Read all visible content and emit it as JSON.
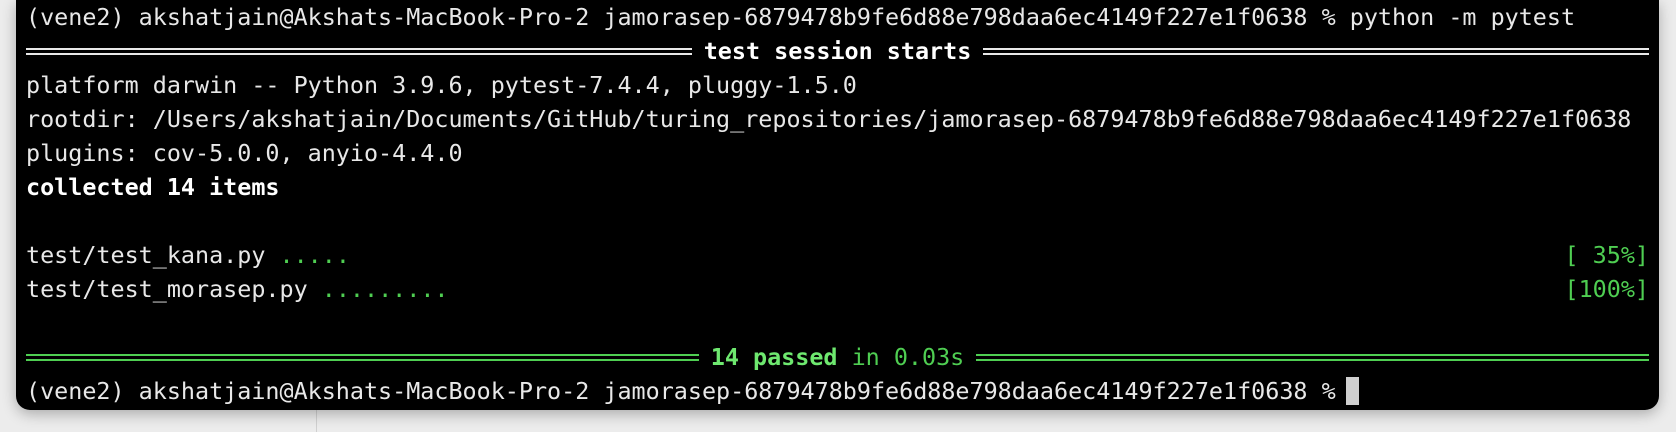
{
  "terminal": {
    "command_line": "(vene2) akshatjain@Akshats-MacBook-Pro-2 jamorasep-6879478b9fe6d88e798daa6ec4149f227e1f0638 % python -m pytest",
    "session_header": "test session starts",
    "platform_line": "platform darwin -- Python 3.9.6, pytest-7.4.4, pluggy-1.5.0",
    "rootdir_line": "rootdir: /Users/akshatjain/Documents/GitHub/turing_repositories/jamorasep-6879478b9fe6d88e798daa6ec4149f227e1f0638",
    "plugins_line": "plugins: cov-5.0.0, anyio-4.4.0",
    "collected_line": "collected 14 items",
    "tests": [
      {
        "file": "test/test_kana.py",
        "dots": ".....",
        "progress": "[ 35%]"
      },
      {
        "file": "test/test_morasep.py",
        "dots": ".........",
        "progress": "[100%]"
      }
    ],
    "summary": {
      "passed": "14 passed",
      "duration": "in 0.03s"
    },
    "prompt_line": "(vene2) akshatjain@Akshats-MacBook-Pro-2 jamorasep-6879478b9fe6d88e798daa6ec4149f227e1f0638 %"
  },
  "colors": {
    "background": "#000000",
    "text": "#e8e8e8",
    "pass_green": "#4fce52",
    "pass_bright_green": "#6ee86f"
  }
}
